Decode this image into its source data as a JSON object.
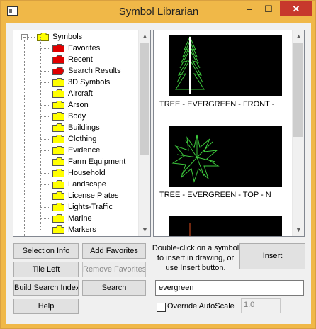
{
  "window": {
    "title": "Symbol Librarian",
    "app_icon": "window-icon",
    "controls": {
      "minimize": "–",
      "maximize": "☐",
      "close": "✕"
    }
  },
  "tree": {
    "root": {
      "label": "Symbols",
      "expander": "–"
    },
    "items": [
      {
        "label": "Favorites",
        "color": "#e00000"
      },
      {
        "label": "Recent",
        "color": "#e00000"
      },
      {
        "label": "Search Results",
        "color": "#e00000",
        "open": true
      },
      {
        "label": "3D Symbols",
        "color": "#ffff00"
      },
      {
        "label": "Aircraft",
        "color": "#ffff00"
      },
      {
        "label": "Arson",
        "color": "#ffff00"
      },
      {
        "label": "Body",
        "color": "#ffff00"
      },
      {
        "label": "Buildings",
        "color": "#ffff00"
      },
      {
        "label": "Clothing",
        "color": "#ffff00"
      },
      {
        "label": "Evidence",
        "color": "#ffff00"
      },
      {
        "label": "Farm Equipment",
        "color": "#ffff00"
      },
      {
        "label": "Household",
        "color": "#ffff00"
      },
      {
        "label": "Landscape",
        "color": "#ffff00"
      },
      {
        "label": "License Plates",
        "color": "#ffff00"
      },
      {
        "label": "Lights-Traffic",
        "color": "#ffff00"
      },
      {
        "label": "Marine",
        "color": "#ffff00"
      },
      {
        "label": "Markers",
        "color": "#ffff00"
      }
    ],
    "scrollbar": {
      "up": "▲",
      "down": "▼"
    }
  },
  "preview": {
    "symbols": [
      {
        "label": "TREE - EVERGREEN - FRONT - ",
        "icon": "evergreen-front-icon"
      },
      {
        "label": "TREE - EVERGREEN - TOP - N",
        "icon": "evergreen-top-icon"
      },
      {
        "label": "",
        "icon": "symbol-thumbnail-icon"
      }
    ],
    "scrollbar": {
      "up": "▲",
      "down": "▼"
    }
  },
  "buttons": {
    "selection_info": "Selection Info",
    "add_favorites": "Add Favorites",
    "tile_left": "Tile Left",
    "remove_favorites": "Remove Favorites",
    "build_search_index": "Build Search Index",
    "search": "Search",
    "help": "Help",
    "insert": "Insert"
  },
  "hint": "Double-click on a symbol to insert in drawing, or use Insert button.",
  "search_value": "evergreen",
  "override": {
    "label": "Override AutoScale",
    "checked": false,
    "scale_value": "1.0"
  },
  "colors": {
    "frame": "#f0b848",
    "close": "#c7392c",
    "folder_yellow": "#ffff00",
    "folder_red": "#e00000",
    "tree_green": "#3cc83c"
  }
}
